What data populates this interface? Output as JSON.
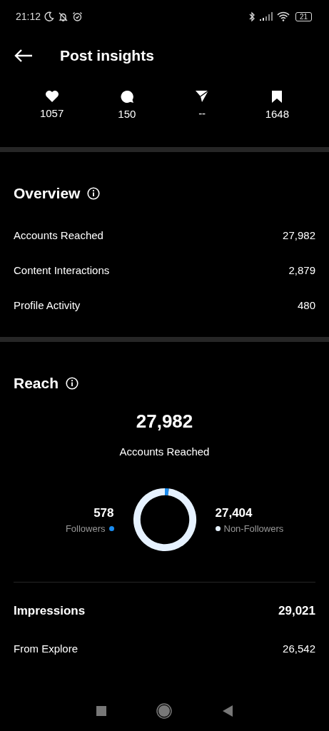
{
  "status_bar": {
    "time": "21:12",
    "battery": "21"
  },
  "header": {
    "title": "Post insights"
  },
  "stats": [
    {
      "kind": "like",
      "value": "1057"
    },
    {
      "kind": "comment",
      "value": "150"
    },
    {
      "kind": "share",
      "value": "--"
    },
    {
      "kind": "save",
      "value": "1648"
    }
  ],
  "overview": {
    "title": "Overview",
    "rows": [
      {
        "label": "Accounts Reached",
        "value": "27,982"
      },
      {
        "label": "Content Interactions",
        "value": "2,879"
      },
      {
        "label": "Profile Activity",
        "value": "480"
      }
    ]
  },
  "reach": {
    "title": "Reach",
    "total": "27,982",
    "total_label": "Accounts Reached",
    "legend": [
      {
        "value": "578",
        "color": "#1a8cf0"
      },
      {
        "value": "27,404",
        "color": "#e6f2ff"
      }
    ],
    "chart_data": {
      "type": "donut",
      "categories": [
        "Followers",
        "Non-Followers"
      ],
      "values": [
        2.07,
        97.93
      ]
    },
    "impressions": {
      "label": "Impressions",
      "value": "29,021"
    },
    "rows": [
      {
        "label": "From Explore",
        "value": "26,542"
      }
    ]
  }
}
